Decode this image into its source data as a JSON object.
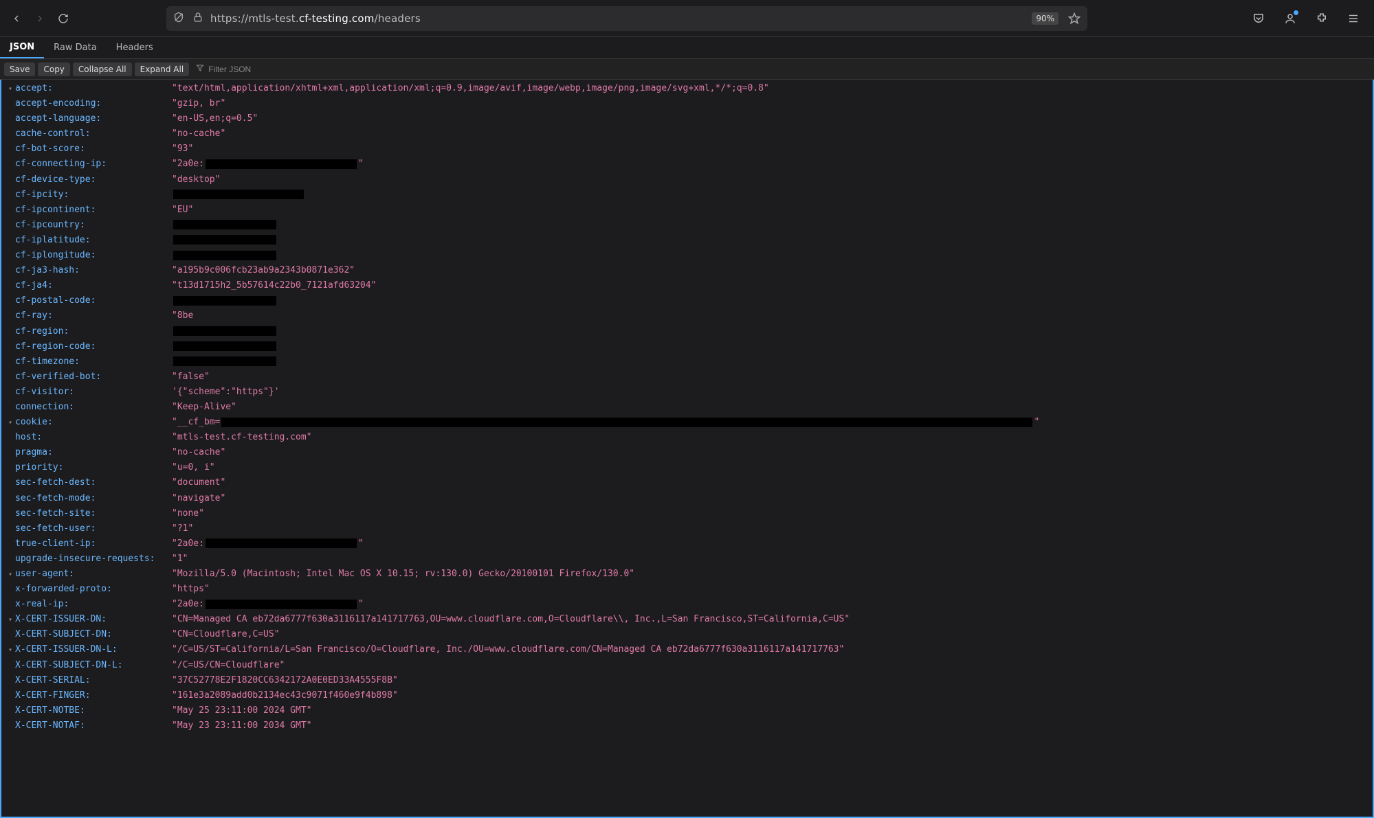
{
  "browser": {
    "url_full": "https://mtls-test.cf-testing.com/headers",
    "url_prefix": "https://mtls-test.",
    "url_highlight": "cf-testing.com",
    "url_suffix": "/headers",
    "zoom": "90%"
  },
  "tabs": {
    "json": "JSON",
    "raw": "Raw Data",
    "headers": "Headers"
  },
  "controls": {
    "save": "Save",
    "copy": "Copy",
    "collapse": "Collapse All",
    "expand": "Expand All",
    "filter_placeholder": "Filter JSON"
  },
  "headers": {
    "accept": {
      "k": "accept:",
      "v": "\"text/html,application/xhtml+xml,application/xml;q=0.9,image/avif,image/webp,image/png,image/svg+xml,*/*;q=0.8\""
    },
    "accept_encoding": {
      "k": "accept-encoding:",
      "v": "\"gzip, br\""
    },
    "accept_language": {
      "k": "accept-language:",
      "v": "\"en-US,en;q=0.5\""
    },
    "cache_control": {
      "k": "cache-control:",
      "v": "\"no-cache\""
    },
    "cf_bot_score": {
      "k": "cf-bot-score:",
      "v": "\"93\""
    },
    "cf_connecting_ip": {
      "k": "cf-connecting-ip:",
      "v_a": "\"2a0e:",
      "v_b": "\"",
      "redact_w": 220
    },
    "cf_device_type": {
      "k": "cf-device-type:",
      "v": "\"desktop\""
    },
    "cf_ipcity": {
      "k": "cf-ipcity:",
      "redact_w": 190
    },
    "cf_ipcontinent": {
      "k": "cf-ipcontinent:",
      "v": "\"EU\""
    },
    "cf_ipcountry": {
      "k": "cf-ipcountry:",
      "redact_w": 150
    },
    "cf_iplatitude": {
      "k": "cf-iplatitude:",
      "redact_w": 150
    },
    "cf_iplongitude": {
      "k": "cf-iplongitude:",
      "redact_w": 150
    },
    "cf_ja3_hash": {
      "k": "cf-ja3-hash:",
      "v": "\"a195b9c006fcb23ab9a2343b0871e362\""
    },
    "cf_ja4": {
      "k": "cf-ja4:",
      "v": "\"t13d1715h2_5b57614c22b0_7121afd63204\""
    },
    "cf_postal_code": {
      "k": "cf-postal-code:",
      "redact_w": 150
    },
    "cf_ray": {
      "k": "cf-ray:",
      "v": "\"8be"
    },
    "cf_region": {
      "k": "cf-region:",
      "redact_w": 150
    },
    "cf_region_code": {
      "k": "cf-region-code:",
      "redact_w": 150
    },
    "cf_timezone": {
      "k": "cf-timezone:",
      "redact_w": 150
    },
    "cf_verified_bot": {
      "k": "cf-verified-bot:",
      "v": "\"false\""
    },
    "cf_visitor": {
      "k": "cf-visitor:",
      "v": "'{\"scheme\":\"https\"}'"
    },
    "connection": {
      "k": "connection:",
      "v": "\"Keep-Alive\""
    },
    "cookie": {
      "k": "cookie:",
      "v_a": "\"__cf_bm=",
      "v_b": "\"",
      "redact_w": 1180
    },
    "host": {
      "k": "host:",
      "v": "\"mtls-test.cf-testing.com\""
    },
    "pragma": {
      "k": "pragma:",
      "v": "\"no-cache\""
    },
    "priority": {
      "k": "priority:",
      "v": "\"u=0, i\""
    },
    "sec_fetch_dest": {
      "k": "sec-fetch-dest:",
      "v": "\"document\""
    },
    "sec_fetch_mode": {
      "k": "sec-fetch-mode:",
      "v": "\"navigate\""
    },
    "sec_fetch_site": {
      "k": "sec-fetch-site:",
      "v": "\"none\""
    },
    "sec_fetch_user": {
      "k": "sec-fetch-user:",
      "v": "\"?1\""
    },
    "true_client_ip": {
      "k": "true-client-ip:",
      "v_a": "\"2a0e:",
      "v_b": "\"",
      "redact_w": 220
    },
    "upgrade_insecure_requests": {
      "k": "upgrade-insecure-requests:",
      "v": "\"1\""
    },
    "user_agent": {
      "k": "user-agent:",
      "v": "\"Mozilla/5.0 (Macintosh; Intel Mac OS X 10.15; rv:130.0) Gecko/20100101 Firefox/130.0\""
    },
    "x_forwarded_proto": {
      "k": "x-forwarded-proto:",
      "v": "\"https\""
    },
    "x_real_ip": {
      "k": "x-real-ip:",
      "v_a": "\"2a0e:",
      "v_b": "\"",
      "redact_w": 220
    },
    "x_cert_issuer_dn": {
      "k": "X-CERT-ISSUER-DN:",
      "v": "\"CN=Managed CA eb72da6777f630a3116117a141717763,OU=www.cloudflare.com,O=Cloudflare\\\\, Inc.,L=San Francisco,ST=California,C=US\""
    },
    "x_cert_subject_dn": {
      "k": "X-CERT-SUBJECT-DN:",
      "v": "\"CN=Cloudflare,C=US\""
    },
    "x_cert_issuer_dn_l": {
      "k": "X-CERT-ISSUER-DN-L:",
      "v": "\"/C=US/ST=California/L=San Francisco/O=Cloudflare, Inc./OU=www.cloudflare.com/CN=Managed CA eb72da6777f630a3116117a141717763\""
    },
    "x_cert_subject_dn_l": {
      "k": "X-CERT-SUBJECT-DN-L:",
      "v": "\"/C=US/CN=Cloudflare\""
    },
    "x_cert_serial": {
      "k": "X-CERT-SERIAL:",
      "v": "\"37C52778E2F1820CC6342172A0E0ED33A4555F8B\""
    },
    "x_cert_finger": {
      "k": "X-CERT-FINGER:",
      "v": "\"161e3a2089add0b2134ec43c9071f460e9f4b898\""
    },
    "x_cert_notbe": {
      "k": "X-CERT-NOTBE:",
      "v": "\"May 25 23:11:00 2024 GMT\""
    },
    "x_cert_notaf": {
      "k": "X-CERT-NOTAF:",
      "v": "\"May 23 23:11:00 2034 GMT\""
    }
  }
}
